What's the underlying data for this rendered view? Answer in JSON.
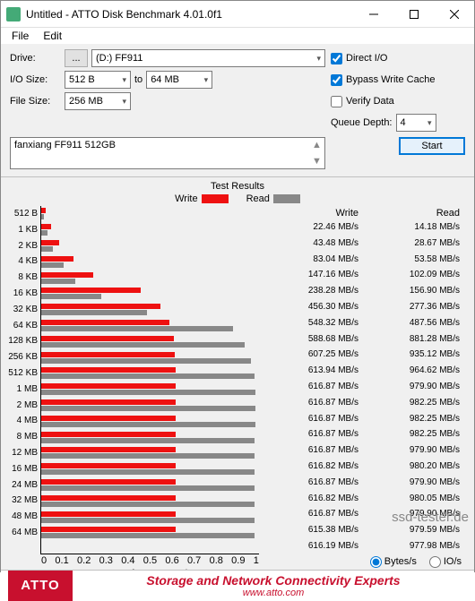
{
  "window": {
    "title": "Untitled - ATTO Disk Benchmark 4.01.0f1"
  },
  "menu": {
    "file": "File",
    "edit": "Edit"
  },
  "labels": {
    "drive": "Drive:",
    "iosize": "I/O Size:",
    "to": "to",
    "filesize": "File Size:",
    "qdepth": "Queue Depth:"
  },
  "drive": {
    "browse": "...",
    "value": "(D:) FF911"
  },
  "iosize": {
    "from": "512 B",
    "to": "64 MB"
  },
  "filesize": "256 MB",
  "checks": {
    "direct": "Direct I/O",
    "bypass": "Bypass Write Cache",
    "verify": "Verify Data"
  },
  "qdepth": "4",
  "start": "Start",
  "desc": "fanxiang FF911 512GB",
  "results_title": "Test Results",
  "legend": {
    "write": "Write",
    "read": "Read"
  },
  "headers": {
    "write": "Write",
    "read": "Read"
  },
  "xaxis_label": "Transfer Rate - GB/s",
  "radios": {
    "bytes": "Bytes/s",
    "ios": "IO/s"
  },
  "footer": {
    "logo": "ATTO",
    "line1": "Storage and Network Connectivity Experts",
    "line2": "www.atto.com"
  },
  "watermark": "ssd-tester.de",
  "chart_data": {
    "type": "bar",
    "orientation": "horizontal",
    "xlabel": "Transfer Rate - GB/s",
    "xlim": [
      0,
      1
    ],
    "xticks": [
      0,
      0.1,
      0.2,
      0.3,
      0.4,
      0.5,
      0.6,
      0.7,
      0.8,
      0.9,
      1
    ],
    "xtick_labels": [
      "0",
      "0.1",
      "0.2",
      "0.3",
      "0.4",
      "0.5",
      "0.6",
      "0.7",
      "0.8",
      "0.9",
      "1"
    ],
    "categories": [
      "512 B",
      "1 KB",
      "2 KB",
      "4 KB",
      "8 KB",
      "16 KB",
      "32 KB",
      "64 KB",
      "128 KB",
      "256 KB",
      "512 KB",
      "1 MB",
      "2 MB",
      "4 MB",
      "8 MB",
      "12 MB",
      "16 MB",
      "24 MB",
      "32 MB",
      "48 MB",
      "64 MB"
    ],
    "unit": "MB/s",
    "series": [
      {
        "name": "Write",
        "color": "#e11",
        "values": [
          22.46,
          43.48,
          83.04,
          147.16,
          238.28,
          456.3,
          548.32,
          588.68,
          607.25,
          613.94,
          616.87,
          616.87,
          616.87,
          616.87,
          616.87,
          616.82,
          616.87,
          616.82,
          616.87,
          615.38,
          616.19
        ]
      },
      {
        "name": "Read",
        "color": "#888",
        "values": [
          14.18,
          28.67,
          53.58,
          102.09,
          156.9,
          277.36,
          487.56,
          881.28,
          935.12,
          964.62,
          979.9,
          982.25,
          982.25,
          982.25,
          979.9,
          980.2,
          979.9,
          980.05,
          979.9,
          979.59,
          977.98
        ]
      }
    ]
  }
}
